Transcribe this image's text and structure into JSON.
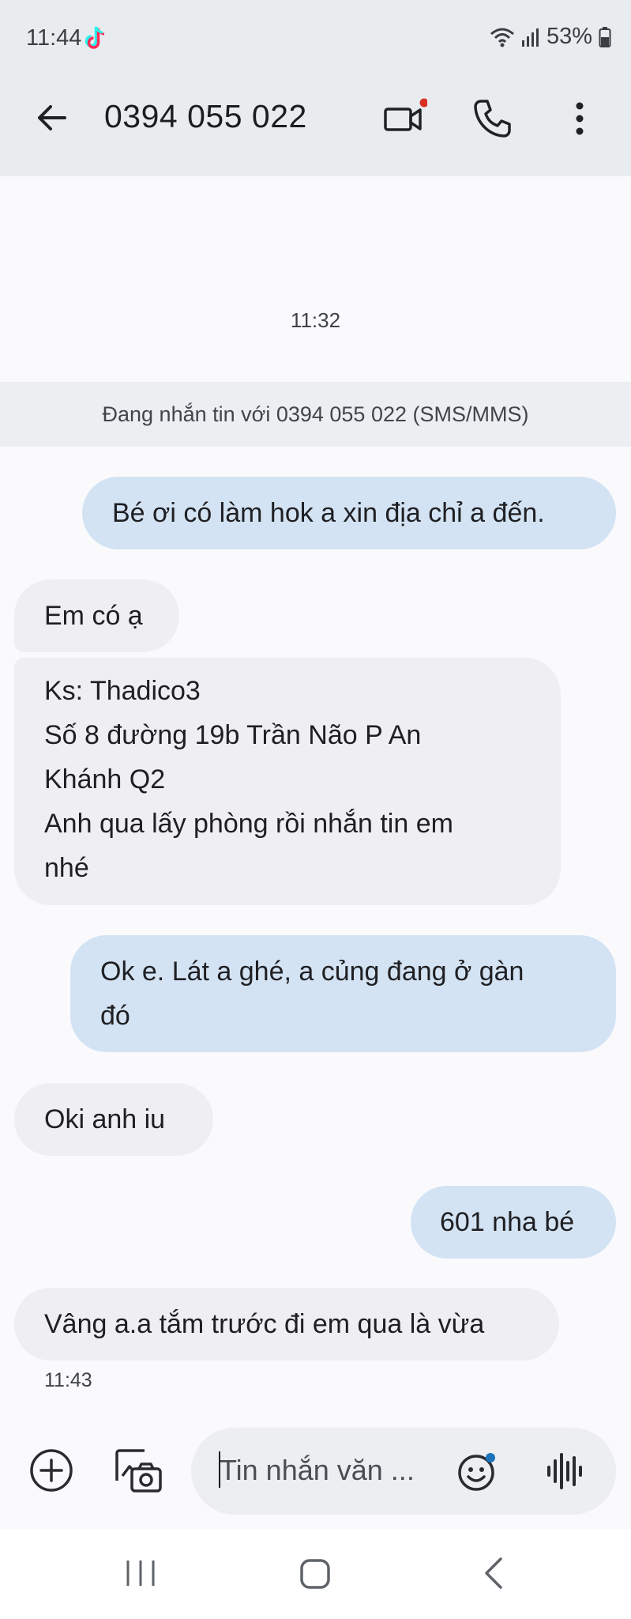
{
  "status_bar": {
    "time": "11:44",
    "battery": "53%",
    "icons": [
      "tiktok-icon",
      "wifi-icon",
      "signal-icon",
      "battery-icon"
    ]
  },
  "header": {
    "contact": "0394 055 022",
    "actions": [
      "video-call-icon",
      "phone-icon",
      "more-options-icon"
    ]
  },
  "conversation": {
    "top_timestamp": "11:32",
    "banner": "Đang nhắn tin với 0394 055 022 (SMS/MMS)",
    "messages": [
      {
        "direction": "outgoing",
        "lines": [
          "Bé ơi có làm hok a xin địa chỉ a đến."
        ]
      },
      {
        "direction": "incoming",
        "lines": [
          "Em có ạ"
        ]
      },
      {
        "direction": "incoming",
        "lines": [
          "Ks: Thadico3",
          "Số 8 đường 19b Trần Não P An",
          "Khánh Q2",
          "Anh qua lấy phòng rồi nhắn tin em",
          "nhé"
        ]
      },
      {
        "direction": "outgoing",
        "lines": [
          "Ok e. Lát a ghé, a củng đang ở gàn",
          "đó"
        ]
      },
      {
        "direction": "incoming",
        "lines": [
          "Oki anh iu"
        ]
      },
      {
        "direction": "outgoing",
        "lines": [
          "601 nha bé"
        ]
      },
      {
        "direction": "incoming",
        "lines": [
          "Vâng a.a tắm trước đi em qua là vừa"
        ]
      }
    ],
    "last_timestamp": "11:43"
  },
  "composer": {
    "placeholder": "Tin nhắn văn ...",
    "value": ""
  },
  "colors": {
    "outgoing_bubble": "#d3e3f3",
    "incoming_bubble": "#efeff1",
    "header_bg": "#e9ecef",
    "notification_dot": "#d93025"
  }
}
